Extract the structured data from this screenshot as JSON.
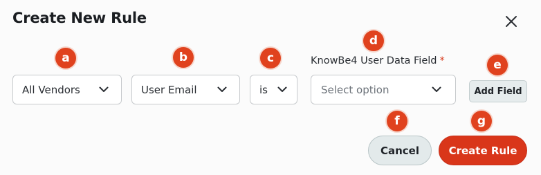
{
  "dialog": {
    "title": "Create New Rule"
  },
  "rule": {
    "vendor": {
      "value": "All Vendors"
    },
    "attribute": {
      "value": "User Email"
    },
    "operator": {
      "value": "is"
    },
    "field": {
      "label": "KnowBe4 User Data Field",
      "required_mark": "*",
      "placeholder": "Select option"
    }
  },
  "buttons": {
    "add_field": "Add Field",
    "cancel": "Cancel",
    "create": "Create Rule"
  },
  "badges": {
    "a": "a",
    "b": "b",
    "c": "c",
    "d": "d",
    "e": "e",
    "f": "f",
    "g": "g"
  },
  "colors": {
    "accent": "#d9361a",
    "badge": "#e0421e",
    "secondary_button": "#e3eaeb"
  },
  "icons": {
    "close": "close-icon",
    "dropdown": "chevron-down-icon"
  }
}
